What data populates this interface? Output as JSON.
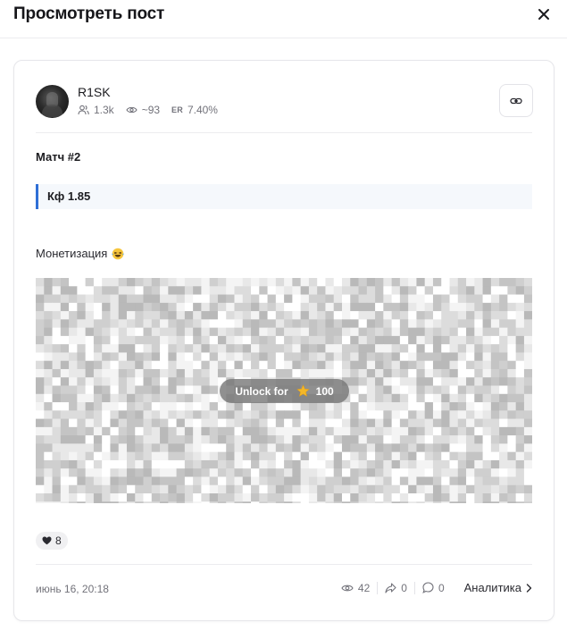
{
  "modal": {
    "title": "Просмотреть пост",
    "close_icon": "close-icon"
  },
  "channel": {
    "name": "R1SK",
    "subscribers": "1.3k",
    "views": "~93",
    "er_label": "ER",
    "er": "7.40%",
    "link_icon": "link-icon"
  },
  "post": {
    "title": "Матч #2",
    "quote": "Кф 1.85",
    "text": "Монетизация",
    "emoji_icon": "laughing-tears-emoji",
    "unlock_label": "Unlock for",
    "unlock_price": "100",
    "unlock_icon": "star-icon"
  },
  "reactions": [
    {
      "icon": "heart-icon",
      "count": "8"
    }
  ],
  "footer": {
    "date": "июнь 16, 20:18",
    "views": "42",
    "shares": "0",
    "comments": "0",
    "analytics_label": "Аналитика"
  },
  "colors": {
    "accent": "#2f6fd6",
    "quote_bg": "#f5f8fc",
    "muted_text": "#72727a",
    "border": "#e6e6ea"
  }
}
